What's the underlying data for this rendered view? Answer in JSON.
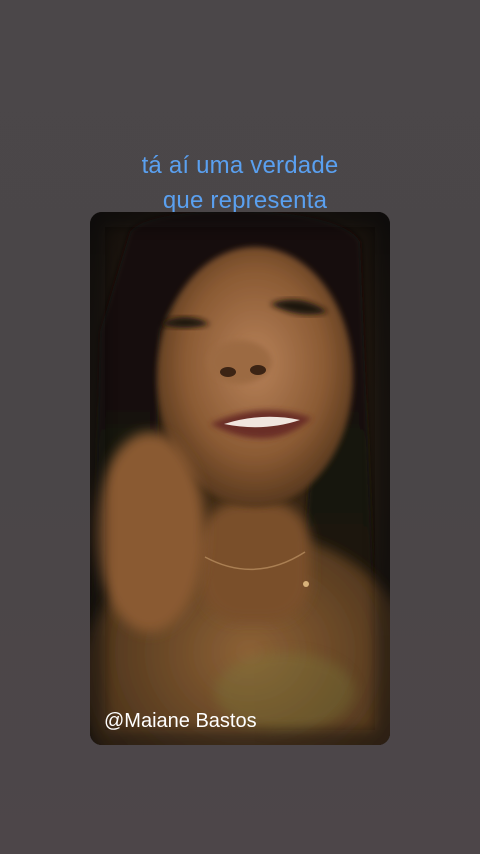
{
  "story": {
    "caption_lines": [
      "tá aí uma verdade",
      "que representa"
    ],
    "author_handle": "@Maiane Bastos"
  },
  "colors": {
    "background": "#4a4648",
    "caption": "#5aa0f0",
    "handle": "#ffffff"
  },
  "icons": {
    "video": "video-thumbnail"
  }
}
